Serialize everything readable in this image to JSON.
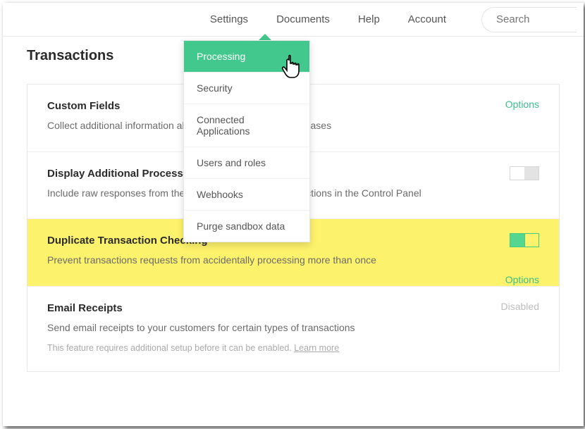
{
  "nav": {
    "settings": "Settings",
    "documents": "Documents",
    "help": "Help",
    "account": "Account"
  },
  "search": {
    "placeholder": "Search"
  },
  "dropdown": {
    "items": [
      "Processing",
      "Security",
      "Connected Applications",
      "Users and roles",
      "Webhooks",
      "Purge sandbox data"
    ]
  },
  "page": {
    "title": "Transactions"
  },
  "rows": {
    "customFields": {
      "title": "Custom Fields",
      "desc": "Collect additional information about your customers or purchases",
      "options": "Options"
    },
    "processor": {
      "title": "Display Additional Processor Responses",
      "desc": "Include raw responses from the processor alongside transactions in the Control Panel"
    },
    "duplicate": {
      "title": "Duplicate Transaction Checking",
      "desc": "Prevent transactions requests from accidentally processing more than once",
      "options": "Options"
    },
    "email": {
      "title": "Email Receipts",
      "desc": "Send email receipts to your customers for certain types of transactions",
      "note": "This feature requires additional setup before it can be enabled. ",
      "learn": "Learn more",
      "disabled": "Disabled"
    }
  }
}
